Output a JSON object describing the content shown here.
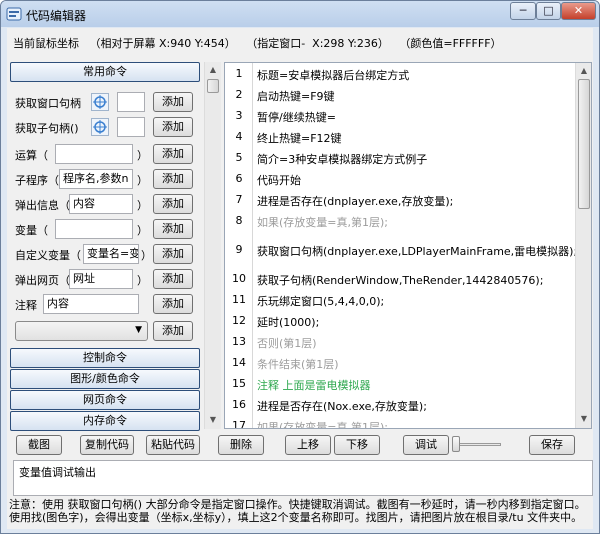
{
  "window": {
    "title": "代码编辑器",
    "min_label": "─",
    "max_label": "□",
    "close_label": "✕"
  },
  "coords": {
    "label": "当前鼠标坐标",
    "screen": "（相对于屏幕 X:940 Y:454）",
    "window": "（指定窗口-  X:298 Y:236）",
    "color": "（颜色值=FFFFFF）"
  },
  "left": {
    "common_cmd": "常用命令",
    "get_window_handle": "获取窗口句柄",
    "get_child_handle": "获取子句柄()",
    "calc_label": "运算（",
    "subprog_label": "子程序（",
    "subprog_value": "程序名,参数n",
    "popup_label": "弹出信息（",
    "popup_value": "内容",
    "var_label": "变量（",
    "custom_var_label": "自定义变量（",
    "custom_var_value": "变量名=变量",
    "web_label": "弹出网页（",
    "web_value": "网址",
    "comment_label": "注释",
    "comment_value": "内容",
    "close_paren": "）",
    "add": "添加",
    "control_cmd": "控制命令",
    "graphics_cmd": "图形/颜色命令",
    "web_cmd": "网页命令",
    "memory_cmd": "内存命令"
  },
  "code_lines": [
    {
      "num": "1",
      "text": "标题=安卓模拟器后台绑定方式"
    },
    {
      "num": "2",
      "text": "启动热键=F9键"
    },
    {
      "num": "3",
      "text": "暂停/继续热键="
    },
    {
      "num": "4",
      "text": "终止热键=F12键"
    },
    {
      "num": "5",
      "text": "简介=3种安卓模拟器绑定方式例子"
    },
    {
      "num": "6",
      "text": "代码开始"
    },
    {
      "num": "7",
      "text": "进程是否存在(dnplayer.exe,存放变量);"
    },
    {
      "num": "8",
      "text": "如果(存放变量=真,第1层);"
    },
    {
      "num": "9",
      "text": "获取窗口句柄(dnplayer.exe,LDPlayerMainFrame,雷电模拟器);"
    },
    {
      "num": "10",
      "text": "获取子句柄(RenderWindow,TheRender,1442840576);"
    },
    {
      "num": "11",
      "text": "乐玩绑定窗口(5,4,4,0,0);"
    },
    {
      "num": "12",
      "text": "延时(1000);"
    },
    {
      "num": "13",
      "text": "否则(第1层)"
    },
    {
      "num": "14",
      "text": "条件结束(第1层)"
    },
    {
      "num": "15",
      "text": "注释 上面是雷电模拟器"
    },
    {
      "num": "16",
      "text": "进程是否存在(Nox.exe,存放变量);"
    },
    {
      "num": "17",
      "text": "如果(存放变量=真,第1层);"
    }
  ],
  "toolbar": {
    "screenshot": "截图",
    "copy_code": "复制代码",
    "paste_code": "粘贴代码",
    "delete": "删除",
    "move_up": "上移",
    "move_down": "下移",
    "debug": "调试",
    "save": "保存"
  },
  "debug_output": "变量值调试输出",
  "note": "注意：使用 获取窗口句柄() 大部分命令是指定窗口操作。快捷键取消调试。截图有一秒延时，请一秒内移到指定窗口。使用找(图色字)，会得出变量（坐标x,坐标y），填上这2个变量名称即可。找图片，请把图片放在根目录/tu 文件夹中。",
  "colors": {
    "accent": "#2fa84f",
    "comment_gray": "#9c9c9c",
    "title_bar": "#b9cee9"
  }
}
